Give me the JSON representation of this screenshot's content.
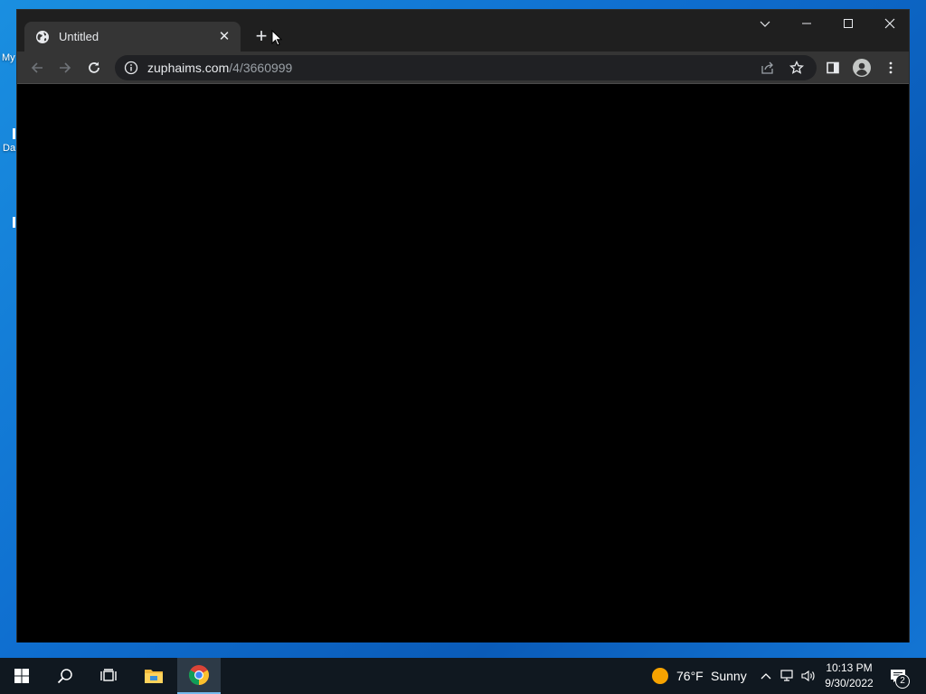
{
  "desktop": {
    "fragments": [
      "My",
      "Da"
    ]
  },
  "browser": {
    "tab": {
      "title": "Untitled",
      "icon": "globe-icon"
    },
    "new_tab_label": "+",
    "address": {
      "host": "zuphaims.com",
      "path": "/4/3660999"
    }
  },
  "taskbar": {
    "weather": {
      "temp": "76°F",
      "condition": "Sunny"
    },
    "clock": {
      "time": "10:13 PM",
      "date": "9/30/2022"
    },
    "notification_count": "2"
  },
  "colors": {
    "titlebar": "#1f1f1f",
    "tab_active": "#353535",
    "toolbar": "#353535",
    "omnibox": "#202124",
    "page_bg": "#000000",
    "taskbar": "#101820",
    "desktop_blue": "#0f6fd0"
  }
}
